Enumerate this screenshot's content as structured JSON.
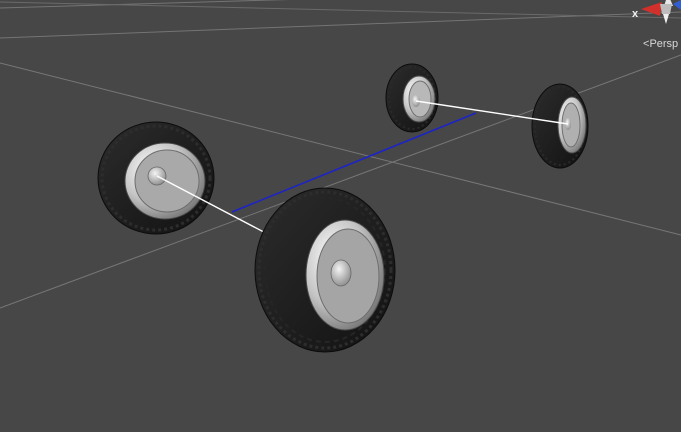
{
  "scene_view": {
    "projection_label": "Persp",
    "projection_arrow": "<",
    "gizmo": {
      "x_axis_label": "x",
      "colors": {
        "x_axis": "#d2302b",
        "y_axis": "#e8e8e8",
        "z_axis": "#2f5fd6"
      }
    },
    "colors": {
      "background": "#474747",
      "grid_line": "#777777",
      "axle_link": "#1c24c8",
      "wheel_link": "#ffffff",
      "tire": "#1c1c1c",
      "rim": "#c8c8c8"
    },
    "objects": {
      "wheels": [
        "front-left-wheel",
        "front-right-wheel",
        "rear-left-wheel",
        "rear-right-wheel"
      ],
      "links": [
        "center-axle",
        "front-axle-link",
        "rear-axle-link"
      ]
    }
  }
}
